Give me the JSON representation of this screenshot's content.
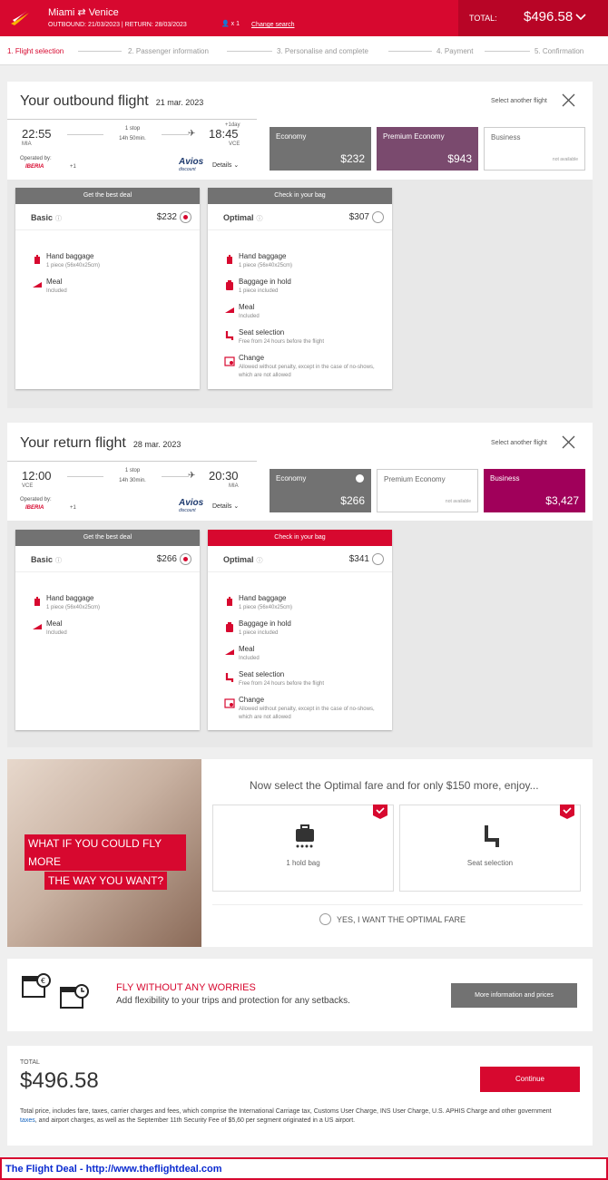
{
  "header": {
    "route_from": "Miami",
    "route_to": "Venice",
    "outbound": "OUTBOUND: 21/03/2023 | RETURN: 28/03/2023",
    "passengers": "x 1",
    "change_search": "Change search",
    "total_label": "TOTAL:",
    "total_amount": "$496.58"
  },
  "steps": [
    "1. Flight selection",
    "2. Passenger information",
    "3. Personalise and complete",
    "4. Payment",
    "5. Confirmation"
  ],
  "outbound": {
    "title": "Your outbound flight",
    "date": "21 mar. 2023",
    "select_another": "Select another flight",
    "dep_time": "22:55",
    "dep_ap": "MIA",
    "stops": "1 stop",
    "duration": "14h 50min.",
    "plus_day": "+1day",
    "arr_time": "18:45",
    "arr_ap": "VCE",
    "operated": "Operated by:",
    "airline": "IBERIA",
    "plus": "+1",
    "avios": "Avios",
    "avios_sub": "discount",
    "details": "Details",
    "cabins": [
      {
        "name": "Economy",
        "price": "$232"
      },
      {
        "name": "Premium Economy",
        "price": "$943"
      },
      {
        "name": "Business",
        "na": "not available"
      }
    ],
    "fares": [
      {
        "banner": "Get the best deal",
        "name": "Basic",
        "price": "$232",
        "features": [
          {
            "t": "Hand baggage",
            "s": "1 piece (56x40x25cm)"
          },
          {
            "t": "Meal",
            "s": "Included"
          }
        ]
      },
      {
        "banner": "Check in your bag",
        "name": "Optimal",
        "price": "$307",
        "features": [
          {
            "t": "Hand baggage",
            "s": "1 piece (56x40x25cm)"
          },
          {
            "t": "Baggage in hold",
            "s": "1 piece included"
          },
          {
            "t": "Meal",
            "s": "Included"
          },
          {
            "t": "Seat selection",
            "s": "Free from 24 hours before the flight"
          },
          {
            "t": "Change",
            "s": "Allowed without penalty, except in the case of no-shows, which are not allowed"
          }
        ]
      }
    ]
  },
  "return": {
    "title": "Your return flight",
    "date": "28 mar. 2023",
    "select_another": "Select another flight",
    "dep_time": "12:00",
    "dep_ap": "VCE",
    "stops": "1 stop",
    "duration": "14h 30min.",
    "arr_time": "20:30",
    "arr_ap": "MIA",
    "operated": "Operated by:",
    "airline": "IBERIA",
    "plus": "+1",
    "avios": "Avios",
    "avios_sub": "discount",
    "details": "Details",
    "cabins": [
      {
        "name": "Economy",
        "price": "$266"
      },
      {
        "name": "Premium Economy",
        "na": "not available"
      },
      {
        "name": "Business",
        "price": "$3,427"
      }
    ],
    "fares": [
      {
        "banner": "Get the best deal",
        "name": "Basic",
        "price": "$266",
        "features": [
          {
            "t": "Hand baggage",
            "s": "1 piece (56x40x25cm)"
          },
          {
            "t": "Meal",
            "s": "Included"
          }
        ]
      },
      {
        "banner": "Check in your bag",
        "name": "Optimal",
        "price": "$341",
        "features": [
          {
            "t": "Hand baggage",
            "s": "1 piece (56x40x25cm)"
          },
          {
            "t": "Baggage in hold",
            "s": "1 piece included"
          },
          {
            "t": "Meal",
            "s": "Included"
          },
          {
            "t": "Seat selection",
            "s": "Free from 24 hours before the flight"
          },
          {
            "t": "Change",
            "s": "Allowed without penalty, except in the case of no-shows, which are not allowed"
          }
        ]
      }
    ]
  },
  "promo": {
    "line1": "WHAT IF YOU COULD FLY MORE",
    "line2": "THE WAY YOU WANT?",
    "title": "Now select the Optimal fare and for only $150 more, enjoy...",
    "box1": "1 hold bag",
    "box2": "Seat selection",
    "yes": "YES, I WANT THE OPTIMAL FARE"
  },
  "worry": {
    "title": "FLY WITHOUT ANY WORRIES",
    "sub": "Add flexibility to your trips and protection for any setbacks.",
    "button": "More information and prices"
  },
  "total": {
    "label": "TOTAL",
    "amount": "$496.58",
    "button": "Continue",
    "note_a": "Total price, includes fare, taxes, carrier charges and fees, which comprise the International Carriage tax, Customs User Charge, INS User Charge, U.S. APHIS Charge and other government ",
    "note_link": "taxes",
    "note_b": ", and airport charges, as well as the September 11th Security Fee of $5,60 per segment originated in a US airport."
  },
  "footer": "The Flight Deal - http://www.theflightdeal.com"
}
